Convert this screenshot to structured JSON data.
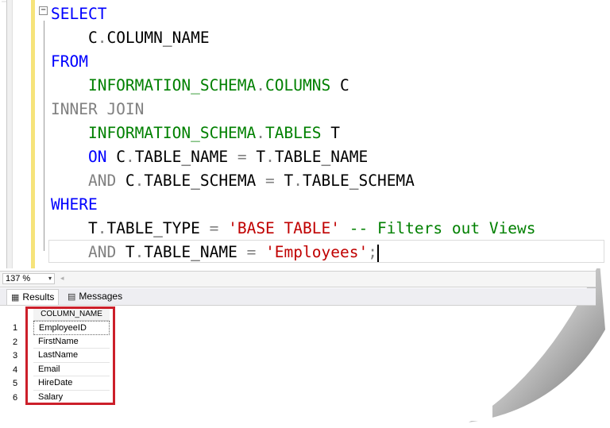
{
  "editor": {
    "lines": [
      [
        {
          "t": "SELECT",
          "c": "kw"
        }
      ],
      [
        {
          "t": "    C",
          "c": ""
        },
        {
          "t": ".",
          "c": "gr"
        },
        {
          "t": "COLUMN_NAME",
          "c": ""
        }
      ],
      [
        {
          "t": "FROM",
          "c": "kw"
        }
      ],
      [
        {
          "t": "    INFORMATION_SCHEMA",
          "c": "fn"
        },
        {
          "t": ".",
          "c": "gr"
        },
        {
          "t": "COLUMNS",
          "c": "fn"
        },
        {
          "t": " C",
          "c": ""
        }
      ],
      [
        {
          "t": "INNER JOIN",
          "c": "gr"
        }
      ],
      [
        {
          "t": "    INFORMATION_SCHEMA",
          "c": "fn"
        },
        {
          "t": ".",
          "c": "gr"
        },
        {
          "t": "TABLES",
          "c": "fn"
        },
        {
          "t": " T",
          "c": ""
        }
      ],
      [
        {
          "t": "    ON",
          "c": "kw"
        },
        {
          "t": " C",
          "c": ""
        },
        {
          "t": ".",
          "c": "gr"
        },
        {
          "t": "TABLE_NAME ",
          "c": ""
        },
        {
          "t": "=",
          "c": "gr"
        },
        {
          "t": " T",
          "c": ""
        },
        {
          "t": ".",
          "c": "gr"
        },
        {
          "t": "TABLE_NAME",
          "c": ""
        }
      ],
      [
        {
          "t": "    AND",
          "c": "gr"
        },
        {
          "t": " C",
          "c": ""
        },
        {
          "t": ".",
          "c": "gr"
        },
        {
          "t": "TABLE_SCHEMA ",
          "c": ""
        },
        {
          "t": "=",
          "c": "gr"
        },
        {
          "t": " T",
          "c": ""
        },
        {
          "t": ".",
          "c": "gr"
        },
        {
          "t": "TABLE_SCHEMA",
          "c": ""
        }
      ],
      [
        {
          "t": "WHERE",
          "c": "kw"
        }
      ],
      [
        {
          "t": "    T",
          "c": ""
        },
        {
          "t": ".",
          "c": "gr"
        },
        {
          "t": "TABLE_TYPE ",
          "c": ""
        },
        {
          "t": "=",
          "c": "gr"
        },
        {
          "t": " ",
          "c": ""
        },
        {
          "t": "'BASE TABLE'",
          "c": "str"
        },
        {
          "t": " -- Filters out Views",
          "c": "cm"
        }
      ],
      [
        {
          "t": "    AND",
          "c": "gr"
        },
        {
          "t": " T",
          "c": ""
        },
        {
          "t": ".",
          "c": "gr"
        },
        {
          "t": "TABLE_NAME ",
          "c": ""
        },
        {
          "t": "=",
          "c": "gr"
        },
        {
          "t": " ",
          "c": ""
        },
        {
          "t": "'Employees'",
          "c": "str"
        },
        {
          "t": ";",
          "c": "gr"
        }
      ]
    ],
    "fold_symbol": "−"
  },
  "zoom": {
    "value": "137 %",
    "arrow": "▾",
    "scroll_arrow": "◂"
  },
  "tabs": [
    {
      "label": "Results",
      "icon": "grid-icon",
      "glyph": "▦",
      "active": true
    },
    {
      "label": "Messages",
      "icon": "messages-icon",
      "glyph": "▤",
      "active": false
    }
  ],
  "results": {
    "column_header": "COLUMN_NAME",
    "rows": [
      {
        "num": "1",
        "value": "EmployeeID"
      },
      {
        "num": "2",
        "value": "FirstName"
      },
      {
        "num": "3",
        "value": "LastName"
      },
      {
        "num": "4",
        "value": "Email"
      },
      {
        "num": "5",
        "value": "HireDate"
      },
      {
        "num": "6",
        "value": "Salary"
      }
    ]
  },
  "colors": {
    "keyword": "#0000ff",
    "gray": "#808080",
    "function": "#008000",
    "string": "#c00000",
    "highlight_border": "#cc1f2a",
    "change_bar": "#f6e37a"
  }
}
